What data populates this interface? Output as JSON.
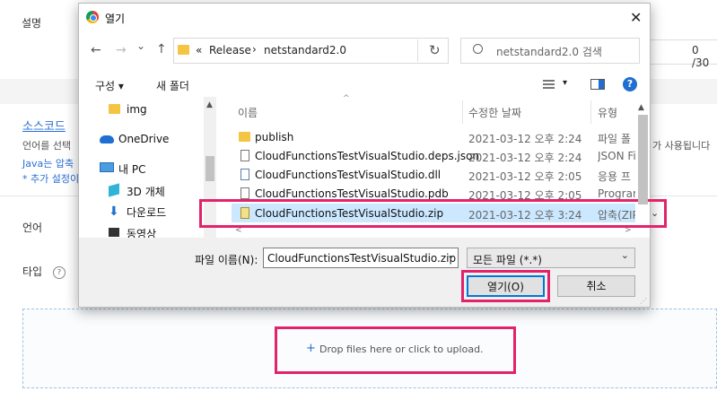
{
  "background": {
    "description_label": "설명",
    "char_count": "0 /30",
    "source_title": "소스코드",
    "source_desc_left": "언어를 선택",
    "source_desc_right": "가 사용됩니다",
    "java_note": "Java는 압축",
    "extra_note": "* 추가 설정이",
    "language_label": "언어",
    "type_label": "타입",
    "type_help": "?",
    "upload_plus": "+",
    "upload_text": "Drop files here or click to upload."
  },
  "dialog": {
    "title": "열기",
    "close": "✕",
    "nav": {
      "back": "←",
      "forward": "→",
      "dropdown": "⌄",
      "up": "↑"
    },
    "address": {
      "prefix": "«",
      "crumb1": "Release",
      "sep": "›",
      "crumb2": "netstandard2.0",
      "refresh": "↻"
    },
    "search_placeholder": "netstandard2.0 검색",
    "toolbar": {
      "organize": "구성 ▾",
      "new_folder": "새 폴더",
      "view": "▾",
      "help": "?"
    },
    "sidebar": [
      {
        "label": "img",
        "icon": "folder-icon"
      },
      {
        "label": "OneDrive",
        "icon": "cloud-icon"
      },
      {
        "label": "내 PC",
        "icon": "pc-icon"
      },
      {
        "label": "3D 개체",
        "icon": "cube-icon"
      },
      {
        "label": "다운로드",
        "icon": "download-icon"
      },
      {
        "label": "동영상",
        "icon": "video-icon"
      }
    ],
    "columns": {
      "name": "이름",
      "date": "수정한 날짜",
      "type": "유형"
    },
    "files": [
      {
        "name": "publish",
        "date": "2021-03-12 오후 2:24",
        "type": "파일 폴",
        "icon": "folder-icon"
      },
      {
        "name": "CloudFunctionsTestVisualStudio.deps.json",
        "date": "2021-03-12 오후 2:24",
        "type": "JSON Fi",
        "icon": "json-file-icon"
      },
      {
        "name": "CloudFunctionsTestVisualStudio.dll",
        "date": "2021-03-12 오후 2:05",
        "type": "응용 프",
        "icon": "dll-file-icon"
      },
      {
        "name": "CloudFunctionsTestVisualStudio.pdb",
        "date": "2021-03-12 오후 2:05",
        "type": "Program",
        "icon": "file-icon"
      },
      {
        "name": "CloudFunctionsTestVisualStudio.zip",
        "date": "2021-03-12 오후 3:24",
        "type": "압축(ZIP",
        "icon": "zip-file-icon"
      }
    ],
    "filename_label": "파일 이름(N):",
    "filename_value": "CloudFunctionsTestVisualStudio.zip",
    "filter_value": "모든 파일 (*.*)",
    "open_button": "열기(O)",
    "cancel_button": "취소"
  },
  "colors": {
    "highlight": "#e2236a",
    "selection": "#cce8ff",
    "link": "#2a6fd6"
  }
}
